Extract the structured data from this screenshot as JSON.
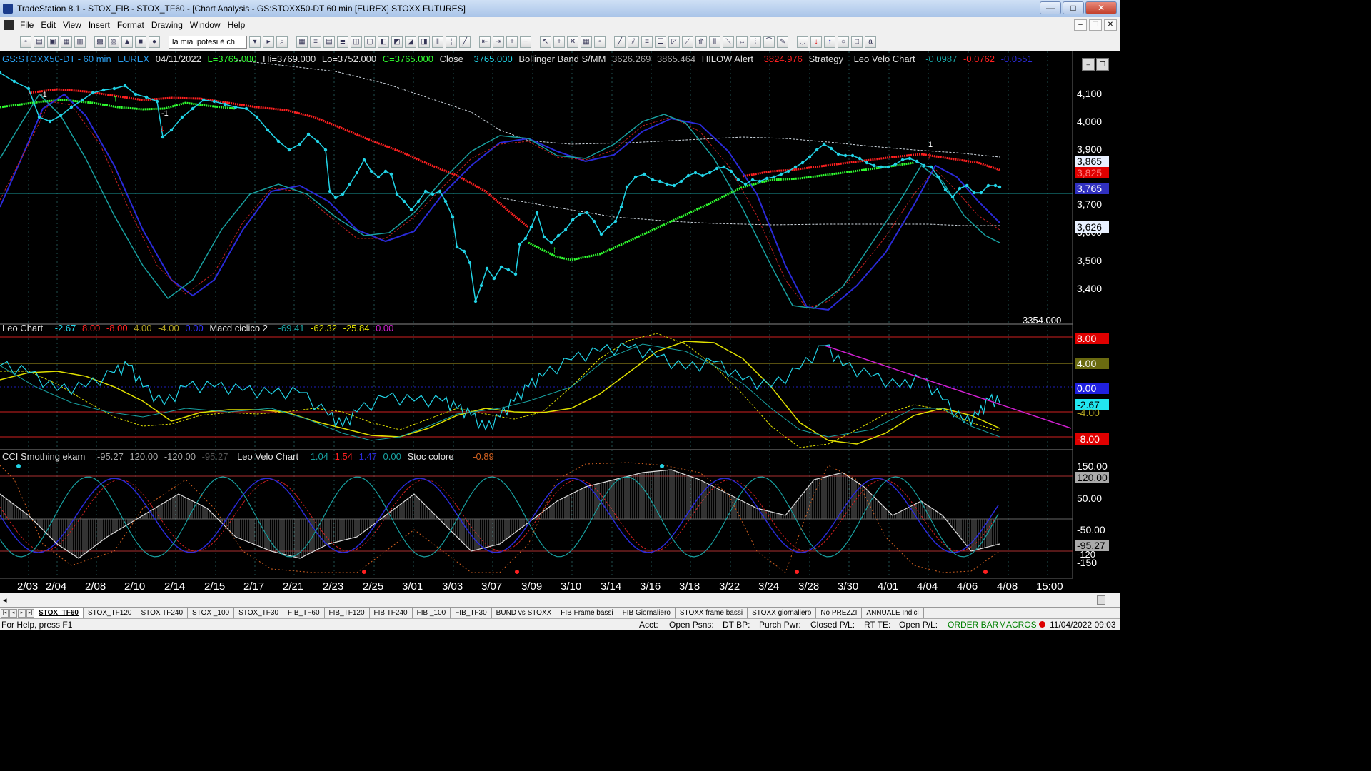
{
  "window": {
    "title": "TradeStation 8.1 - STOX_FIB - STOX_TF60 - [Chart Analysis - GS:STOXX50-DT  60 min  [EUREX] STOXX FUTURES]",
    "minimize": "—",
    "maximize": "□",
    "close": "✕"
  },
  "menu": [
    "File",
    "Edit",
    "View",
    "Insert",
    "Format",
    "Drawing",
    "Window",
    "Help"
  ],
  "toolbar": {
    "workspace_select": "la mia ipotesi è ch",
    "icons": [
      "new-icon",
      "open-icon",
      "save-icon",
      "print-icon",
      "chart-icon",
      "radar-icon",
      "matrix-icon",
      "hotlist-icon",
      "quote-icon",
      "zoom-in-icon",
      "zoom-out-icon",
      "pointer-icon",
      "drawing-icon",
      "trendline-icon",
      "fibonacci-icon",
      "text-icon"
    ]
  },
  "header": {
    "symbol": "GS:STOXX50-DT - 60 min",
    "exchange": "EUREX",
    "date": "04/11/2022",
    "last": "L=3765.000",
    "high": "Hi=3769.000",
    "low": "Lo=3752.000",
    "close_eq": "C=3765.000",
    "close_label": "Close",
    "close_val": "3765.000",
    "bb_label": "Bollinger Band S/MM",
    "bb_v1": "3626.269",
    "bb_v2": "3865.464",
    "hilow_label": "HILOW Alert",
    "hilow_val": "3824.976",
    "strategy": "Strategy",
    "leovelo_label": "Leo Velo Chart",
    "lv1": "-0.0987",
    "lv2": "-0.0762",
    "lv3": "-0.0551"
  },
  "subpanel1": {
    "leo_label": "Leo Chart",
    "v1": "-2.67",
    "v2": "8.00",
    "v3": "-8.00",
    "v4": "4.00",
    "v5": "-4.00",
    "v6": "0.00",
    "macd_label": "Macd ciclico 2",
    "m1": "-69.41",
    "m2": "-62.32",
    "m3": "-25.84",
    "m4": "0.00"
  },
  "subpanel2": {
    "cci_label": "CCI Smothing ekam",
    "c1": "-95.27",
    "c2": "120.00",
    "c3": "-120.00",
    "c4": "-95.27",
    "leovelo_label": "Leo Velo Chart",
    "l1": "1.04",
    "l2": "1.54",
    "l3": "1.47",
    "l4": "0.00",
    "stoc_label": "Stoc colore",
    "s1": "-0.89"
  },
  "price_axis": [
    "4,100",
    "4,000",
    "3,900",
    "3,700",
    "3,600",
    "3,500",
    "3,400",
    "3354.000"
  ],
  "price_boxes": {
    "p1": "3,865",
    "p2": "3,825",
    "p3": "3,765",
    "p4": "3,626"
  },
  "osc1_axis": {
    "a1": "8.00",
    "a2": "4.00",
    "a3": "0.00",
    "a4": "-2.67",
    "a5": "-4.00",
    "a6": "-8.00"
  },
  "osc2_axis": {
    "a1": "150.00",
    "a2": "120.00",
    "a3": "50.00",
    "a4": "-50.00",
    "a5": "-95.27",
    "a6": "-120",
    "a7": "-150"
  },
  "dates": [
    "2/03",
    "2/04",
    "2/08",
    "2/10",
    "2/14",
    "2/15",
    "2/17",
    "2/21",
    "2/23",
    "2/25",
    "3/01",
    "3/03",
    "3/07",
    "3/09",
    "3/10",
    "3/14",
    "3/16",
    "3/18",
    "3/22",
    "3/24",
    "3/28",
    "3/30",
    "4/01",
    "4/04",
    "4/06",
    "4/08",
    "15:00"
  ],
  "markers": {
    "m1": "-1",
    "m2": "-1",
    "m3": "1",
    "m4": "-1"
  },
  "tabs": [
    "STOX_TF60",
    "STOX_TF120",
    "STOX TF240",
    "STOX _100",
    "STOX_TF30",
    "FIB_TF60",
    "FIB_TF120",
    "FIB TF240",
    "FIB _100",
    "FIB_TF30",
    "BUND vs STOXX",
    "FIB Frame bassi",
    "FIB Giornaliero",
    "STOXX frame bassi",
    "STOXX giornaliero",
    "No PREZZI",
    "ANNUALE Indici"
  ],
  "status": {
    "help": "For Help, press F1",
    "acct": "Acct:",
    "open_psns": "Open Psns:",
    "dt_bp": "DT BP:",
    "purch_pwr": "Purch Pwr:",
    "closed_pl": "Closed P/L:",
    "rt_te": "RT TE:",
    "open_pl": "Open P/L:",
    "order_bar": "ORDER BAR",
    "macros": "MACROS",
    "datetime": "11/04/2022 09:03"
  },
  "colors": {
    "price_dots": "#22d3e6",
    "bb_red": "#ff2020",
    "bb_green": "#30ff30",
    "wave_blue": "#2020c8",
    "wave_teal": "#1aa0a0",
    "yellow": "#e6e600",
    "magenta": "#d020d0"
  }
}
